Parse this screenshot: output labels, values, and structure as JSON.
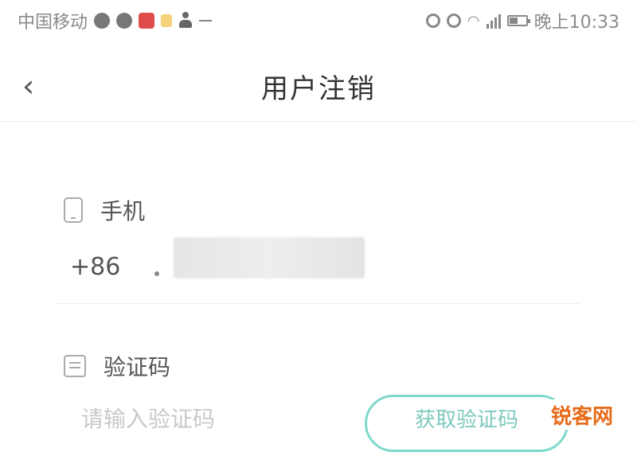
{
  "status_bar": {
    "carrier": "中国移动",
    "time": "晚上10:33",
    "left_icons": [
      "message-icon",
      "chat-icon",
      "notification-icon",
      "file-icon",
      "person-icon",
      "dash-icon"
    ],
    "right_icons": [
      "vibrate-icon",
      "alarm-icon",
      "wifi-icon",
      "signal-icon",
      "battery-icon"
    ]
  },
  "header": {
    "back_icon": "chevron-left-icon",
    "title": "用户注销"
  },
  "phone_field": {
    "icon": "phone-icon",
    "label": "手机",
    "country_code": "+86",
    "value_redacted": true
  },
  "code_field": {
    "icon": "verification-code-icon",
    "label": "验证码",
    "placeholder": "请输入验证码",
    "get_code_button": "获取验证码"
  },
  "watermark": "锐客网",
  "colors": {
    "accent": "#7fd8cc",
    "watermark": "#e86b1a"
  }
}
